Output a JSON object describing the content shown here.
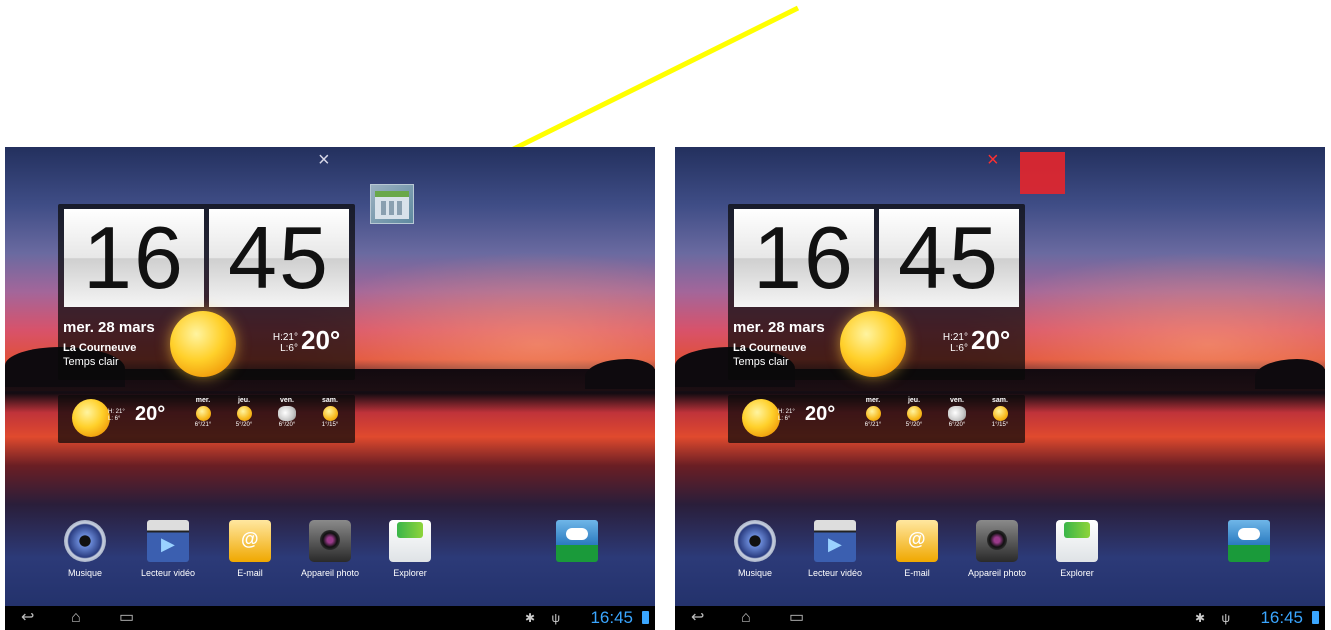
{
  "screens": [
    {
      "id": "before",
      "clock": {
        "hour": "16",
        "minute": "45"
      },
      "weather": {
        "date": "mer. 28 mars",
        "city": "La Courneuve",
        "condition": "Temps clair",
        "high": "H:21°",
        "low": "L:6°",
        "temp": "20°"
      },
      "forecast": {
        "high": "H: 21°",
        "low": "L: 6°",
        "temp": "20°",
        "days": [
          {
            "name": "mer.",
            "range": "6°/21°",
            "icon": "sun-icon"
          },
          {
            "name": "jeu.",
            "range": "5°/20°",
            "icon": "sun-icon"
          },
          {
            "name": "ven.",
            "range": "6°/20°",
            "icon": "cloud-icon"
          },
          {
            "name": "sam.",
            "range": "1°/15°",
            "icon": "sun-icon"
          }
        ]
      },
      "remove_glyph": "×",
      "dock": [
        {
          "label": "Musique",
          "icon": "music-icon"
        },
        {
          "label": "Lecteur vidéo",
          "icon": "video-player-icon"
        },
        {
          "label": "E-mail",
          "icon": "email-icon"
        },
        {
          "label": "Appareil photo",
          "icon": "camera-icon"
        },
        {
          "label": "Explorer",
          "icon": "explorer-icon"
        }
      ],
      "nav": {
        "back": "↩",
        "home": "⌂",
        "recent": "▭",
        "time": "16:45"
      }
    },
    {
      "id": "after",
      "clock": {
        "hour": "16",
        "minute": "45"
      },
      "weather": {
        "date": "mer. 28 mars",
        "city": "La Courneuve",
        "condition": "Temps clair",
        "high": "H:21°",
        "low": "L:6°",
        "temp": "20°"
      },
      "forecast": {
        "high": "H: 21°",
        "low": "L: 6°",
        "temp": "20°",
        "days": [
          {
            "name": "mer.",
            "range": "6°/21°",
            "icon": "sun-icon"
          },
          {
            "name": "jeu.",
            "range": "5°/20°",
            "icon": "sun-icon"
          },
          {
            "name": "ven.",
            "range": "6°/20°",
            "icon": "cloud-icon"
          },
          {
            "name": "sam.",
            "range": "1°/15°",
            "icon": "sun-icon"
          }
        ]
      },
      "remove_glyph": "×",
      "dock": [
        {
          "label": "Musique",
          "icon": "music-icon"
        },
        {
          "label": "Lecteur vidéo",
          "icon": "video-player-icon"
        },
        {
          "label": "E-mail",
          "icon": "email-icon"
        },
        {
          "label": "Appareil photo",
          "icon": "camera-icon"
        },
        {
          "label": "Explorer",
          "icon": "explorer-icon"
        }
      ],
      "nav": {
        "back": "↩",
        "home": "⌂",
        "recent": "▭",
        "time": "16:45"
      }
    }
  ],
  "colors": {
    "annotation_arrow": "#ffff00",
    "remove_zone": "#e2262e",
    "clock_text": "#3aa6ff"
  }
}
